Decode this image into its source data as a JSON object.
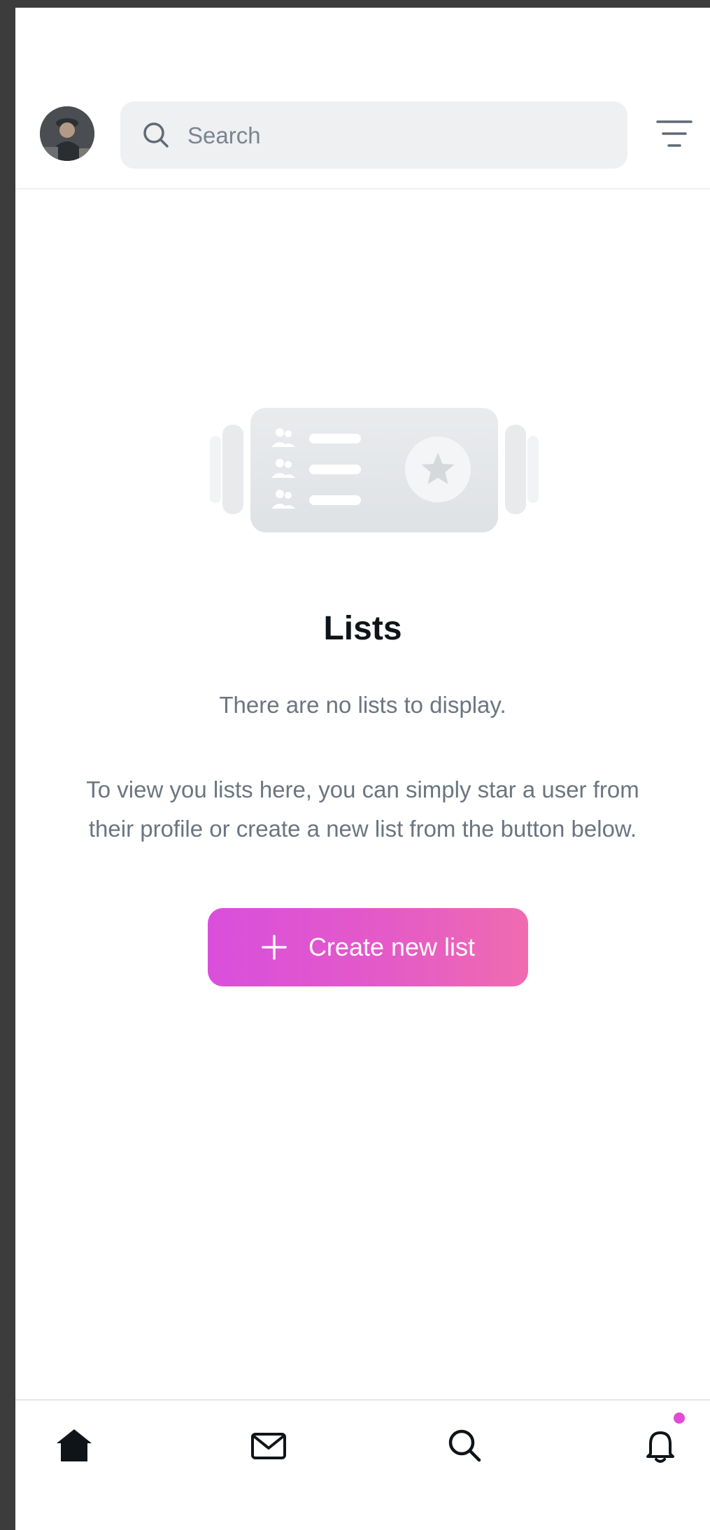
{
  "header": {
    "search": {
      "placeholder": "Search",
      "value": ""
    }
  },
  "icons": {
    "avatar": "user-avatar",
    "search": "search-icon",
    "filter": "filter-icon",
    "illustration": "lists-illustration",
    "plus": "plus-icon",
    "home": "home-icon",
    "mail": "mail-icon",
    "nav_search": "search-icon",
    "bell": "bell-icon"
  },
  "empty_state": {
    "title": "Lists",
    "subtitle": "There are no lists to display.",
    "description": "To view you lists here, you can simply star a user from their profile or create a new list from the button below.",
    "button_label": "Create new list"
  },
  "colors": {
    "accent_start": "#d94fdc",
    "accent_end": "#f06bb0",
    "notification_dot": "#e24bd6",
    "text_primary": "#0f1419",
    "text_secondary": "#6b7580"
  }
}
